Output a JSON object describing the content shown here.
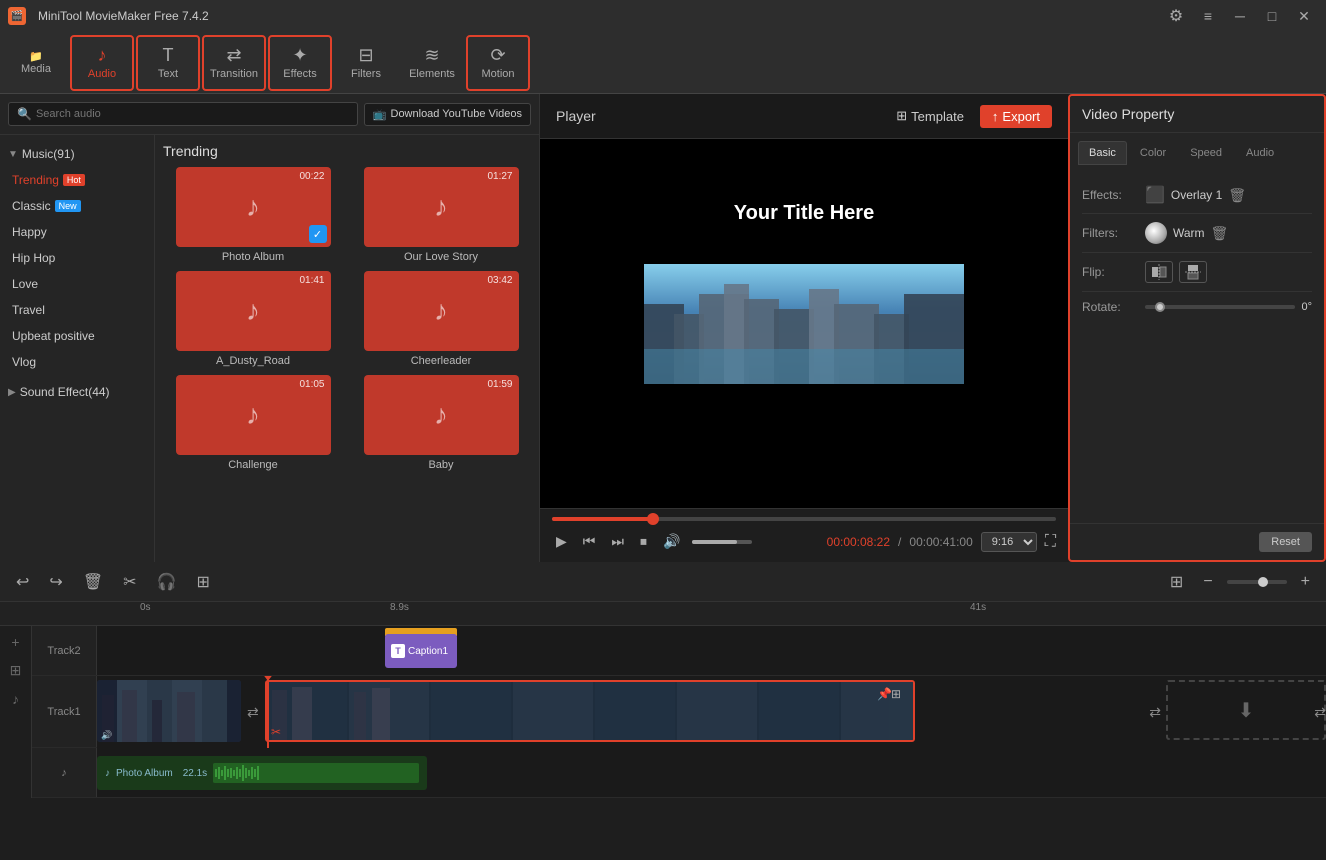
{
  "app": {
    "title": "MiniTool MovieMaker Free 7.4.2",
    "icon": "🎬"
  },
  "titlebar": {
    "minimize": "─",
    "maximize": "□",
    "close": "✕",
    "settings_icon": "⚙",
    "bars_icon": "≡"
  },
  "toolbar": {
    "media_label": "Media",
    "audio_label": "Audio",
    "text_label": "Text",
    "transition_label": "Transition",
    "effects_label": "Effects",
    "filters_label": "Filters",
    "elements_label": "Elements",
    "motion_label": "Motion"
  },
  "leftpanel": {
    "search_placeholder": "Search audio",
    "yt_btn_label": "Download YouTube Videos",
    "section_title": "Trending",
    "categories": [
      {
        "id": "trending",
        "label": "Trending",
        "badge": "Hot",
        "active": true
      },
      {
        "id": "classic",
        "label": "Classic",
        "badge_new": "New"
      },
      {
        "id": "happy",
        "label": "Happy"
      },
      {
        "id": "hiphop",
        "label": "Hip Hop"
      },
      {
        "id": "love",
        "label": "Love"
      },
      {
        "id": "travel",
        "label": "Travel"
      },
      {
        "id": "upbeat",
        "label": "Upbeat positive"
      },
      {
        "id": "vlog",
        "label": "Vlog"
      }
    ],
    "groups": [
      {
        "label": "Music(91)",
        "expanded": true
      },
      {
        "label": "Sound Effect(44)",
        "expanded": false
      }
    ],
    "music_cards": [
      {
        "title": "Photo Album",
        "duration": "00:22",
        "checked": true
      },
      {
        "title": "Our Love Story",
        "duration": "01:27",
        "checked": false
      },
      {
        "title": "A_Dusty_Road",
        "duration": "01:41",
        "checked": false
      },
      {
        "title": "Cheerleader",
        "duration": "03:42",
        "checked": false
      },
      {
        "title": "Challenge",
        "duration": "01:05",
        "checked": false
      },
      {
        "title": "Baby",
        "duration": "01:59",
        "checked": false
      }
    ]
  },
  "player": {
    "title": "Player",
    "template_btn": "Template",
    "export_btn": "Export",
    "video_title": "Your Title Here",
    "progress_pct": 20,
    "time_current": "00:00:08:22",
    "time_total": "00:00:41:00",
    "aspect_ratio": "9:16",
    "play_icon": "▶",
    "prev_icon": "⏮",
    "next_icon": "⏭",
    "stop_icon": "⏹",
    "volume_icon": "🔊"
  },
  "right_panel": {
    "title": "Video Property",
    "tabs": [
      "Basic",
      "Color",
      "Speed",
      "Audio"
    ],
    "active_tab": "Basic",
    "effects_label": "Effects:",
    "effects_value": "Overlay 1",
    "filters_label": "Filters:",
    "filters_value": "Warm",
    "flip_label": "Flip:",
    "rotate_label": "Rotate:",
    "rotate_value": "0°",
    "reset_btn": "Reset"
  },
  "timeline": {
    "undo_icon": "↩",
    "redo_icon": "↪",
    "delete_icon": "🗑",
    "cut_icon": "✂",
    "audio_icon": "🎧",
    "crop_icon": "⊞",
    "time_start": "0s",
    "time_mid": "8.9s",
    "time_end": "41s",
    "track2_label": "Track2",
    "track1_label": "Track1",
    "caption_text": "Caption1",
    "audio_track_label": "♪",
    "audio_clip_name": "Photo Album",
    "audio_clip_duration": "22.1s",
    "add_clip_icon": "⬇"
  }
}
